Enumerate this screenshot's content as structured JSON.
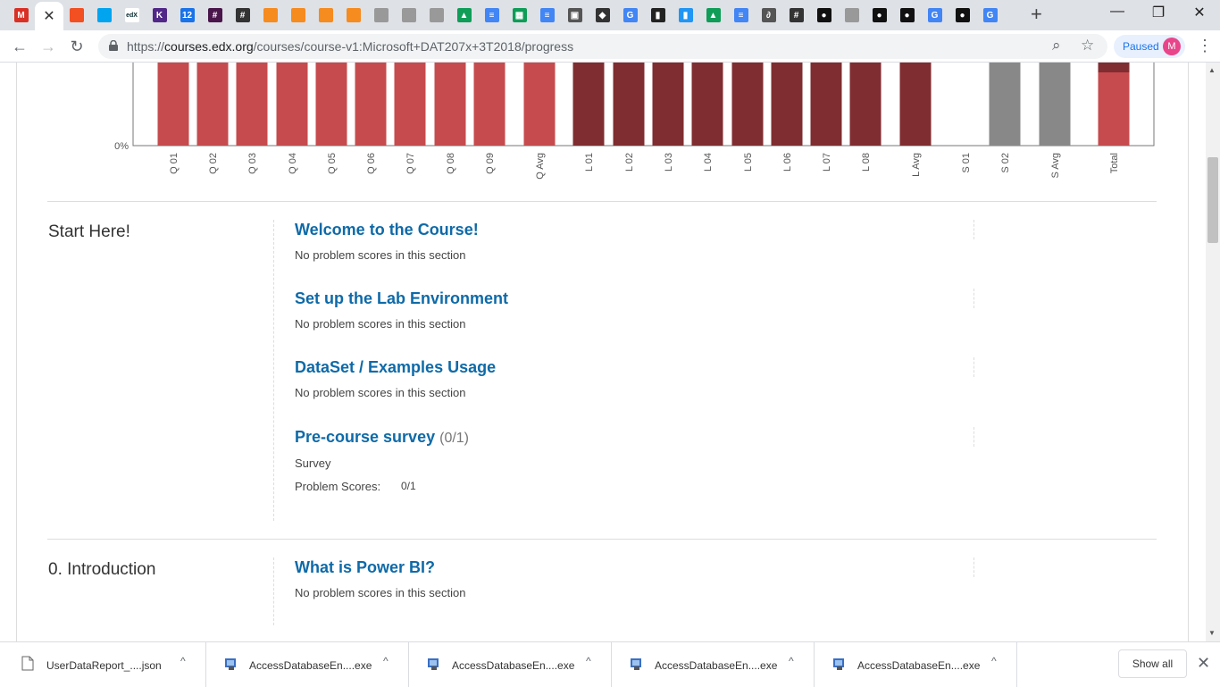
{
  "browser": {
    "tabs": [
      {
        "icon": "gmail-icon",
        "color": "#d93025",
        "glyph": "M"
      },
      {
        "icon": "close-icon",
        "glyph": "✕",
        "active": true
      },
      {
        "icon": "microsoft-icon",
        "color": "#f25022",
        "glyph": ""
      },
      {
        "icon": "microsoft-icon",
        "color": "#00a4ef",
        "glyph": ""
      },
      {
        "icon": "edx-icon",
        "color": "#02262b",
        "glyph": "edX"
      },
      {
        "icon": "kstate-icon",
        "color": "#512888",
        "glyph": "K"
      },
      {
        "icon": "calendar-icon",
        "color": "#1a73e8",
        "glyph": "12"
      },
      {
        "icon": "slack-icon",
        "color": "#4a154b",
        "glyph": "#"
      },
      {
        "icon": "hashtag-icon",
        "color": "#333",
        "glyph": "#"
      },
      {
        "icon": "box-icon",
        "color": "#f68b1f",
        "glyph": ""
      },
      {
        "icon": "box-icon",
        "color": "#f68b1f",
        "glyph": ""
      },
      {
        "icon": "box-icon",
        "color": "#f68b1f",
        "glyph": ""
      },
      {
        "icon": "box-icon",
        "color": "#f68b1f",
        "glyph": ""
      },
      {
        "icon": "doc-icon",
        "color": "#999",
        "glyph": ""
      },
      {
        "icon": "doc-icon",
        "color": "#999",
        "glyph": ""
      },
      {
        "icon": "doc-icon",
        "color": "#999",
        "glyph": ""
      },
      {
        "icon": "drive-icon",
        "color": "#0f9d58",
        "glyph": "▲"
      },
      {
        "icon": "docs-icon",
        "color": "#4285f4",
        "glyph": "≡"
      },
      {
        "icon": "sheets-icon",
        "color": "#0f9d58",
        "glyph": "▦"
      },
      {
        "icon": "docs-icon",
        "color": "#4285f4",
        "glyph": "≡"
      },
      {
        "icon": "image-icon",
        "color": "#555",
        "glyph": "▣"
      },
      {
        "icon": "cube-icon",
        "color": "#333",
        "glyph": "◆"
      },
      {
        "icon": "google-icon",
        "color": "#4285f4",
        "glyph": "G"
      },
      {
        "icon": "chart-icon",
        "color": "#222",
        "glyph": "▮"
      },
      {
        "icon": "puzzle-icon",
        "color": "#2196f3",
        "glyph": "▮"
      },
      {
        "icon": "drive-icon",
        "color": "#0f9d58",
        "glyph": "▲"
      },
      {
        "icon": "docs-icon",
        "color": "#4285f4",
        "glyph": "≡"
      },
      {
        "icon": "swirl-icon",
        "color": "#555",
        "glyph": "∂"
      },
      {
        "icon": "hashtag-icon",
        "color": "#333",
        "glyph": "#"
      },
      {
        "icon": "github-icon",
        "color": "#111",
        "glyph": "●"
      },
      {
        "icon": "doc-icon",
        "color": "#999",
        "glyph": ""
      },
      {
        "icon": "github-icon",
        "color": "#111",
        "glyph": "●"
      },
      {
        "icon": "github-icon",
        "color": "#111",
        "glyph": "●"
      },
      {
        "icon": "google-icon",
        "color": "#4285f4",
        "glyph": "G"
      },
      {
        "icon": "github-icon",
        "color": "#111",
        "glyph": "●"
      },
      {
        "icon": "google-icon",
        "color": "#4285f4",
        "glyph": "G"
      }
    ],
    "new_tab": "+",
    "window": {
      "minimize": "—",
      "maximize": "❐",
      "close": "✕"
    },
    "nav": {
      "back": "←",
      "forward": "→",
      "reload": "↻"
    },
    "url_scheme": "https://",
    "url_host": "courses.edx.org",
    "url_path": "/courses/course-v1:Microsoft+DAT207x+3T2018/progress",
    "zoom_icon": "⌕",
    "star_icon": "☆",
    "profile_status": "Paused",
    "avatar_letter": "M",
    "menu": "⋮"
  },
  "chart_data": {
    "type": "bar",
    "categories": [
      "Q 01",
      "Q 02",
      "Q 03",
      "Q 04",
      "Q 05",
      "Q 06",
      "Q 07",
      "Q 08",
      "Q 09",
      "Q Avg",
      "L 01",
      "L 02",
      "L 03",
      "L 04",
      "L 05",
      "L 06",
      "L 07",
      "L 08",
      "L Avg",
      "S 01",
      "S 02",
      "S Avg",
      "Total"
    ],
    "values": [
      100,
      100,
      100,
      100,
      100,
      100,
      100,
      100,
      100,
      100,
      100,
      100,
      100,
      100,
      100,
      100,
      100,
      100,
      100,
      0,
      100,
      100,
      100
    ],
    "colors": [
      "#c64b4e",
      "#c64b4e",
      "#c64b4e",
      "#c64b4e",
      "#c64b4e",
      "#c64b4e",
      "#c64b4e",
      "#c64b4e",
      "#c64b4e",
      "#c64b4e",
      "#7f2d30",
      "#7f2d30",
      "#7f2d30",
      "#7f2d30",
      "#7f2d30",
      "#7f2d30",
      "#7f2d30",
      "#7f2d30",
      "#7f2d30",
      "#ffffff",
      "#888888",
      "#888888",
      "#c64b4e"
    ],
    "total_stack_top_color": "#7f2d30",
    "y_tick_label": "0%",
    "ylim": [
      0,
      100
    ]
  },
  "sections": [
    {
      "chapter": "Start Here!",
      "subsections": [
        {
          "title": "Welcome to the Course!",
          "score": "",
          "note": "No problem scores in this section"
        },
        {
          "title": "Set up the Lab Environment",
          "score": "",
          "note": "No problem scores in this section"
        },
        {
          "title": "DataSet / Examples Usage",
          "score": "",
          "note": "No problem scores in this section"
        },
        {
          "title": "Pre-course survey",
          "score": "(0/1)",
          "note": "Survey",
          "scores_label": "Problem Scores:",
          "scores_value": "0/1"
        }
      ]
    },
    {
      "chapter": "0. Introduction",
      "subsections": [
        {
          "title": "What is Power BI?",
          "score": "",
          "note": "No problem scores in this section"
        }
      ]
    }
  ],
  "downloads": {
    "items": [
      {
        "name": "UserDataReport_....json",
        "icon": "file-icon"
      },
      {
        "name": "AccessDatabaseEn....exe",
        "icon": "installer-icon"
      },
      {
        "name": "AccessDatabaseEn....exe",
        "icon": "installer-icon"
      },
      {
        "name": "AccessDatabaseEn....exe",
        "icon": "installer-icon"
      },
      {
        "name": "AccessDatabaseEn....exe",
        "icon": "installer-icon"
      }
    ],
    "chevron": "^",
    "show_all": "Show all",
    "close": "✕"
  }
}
